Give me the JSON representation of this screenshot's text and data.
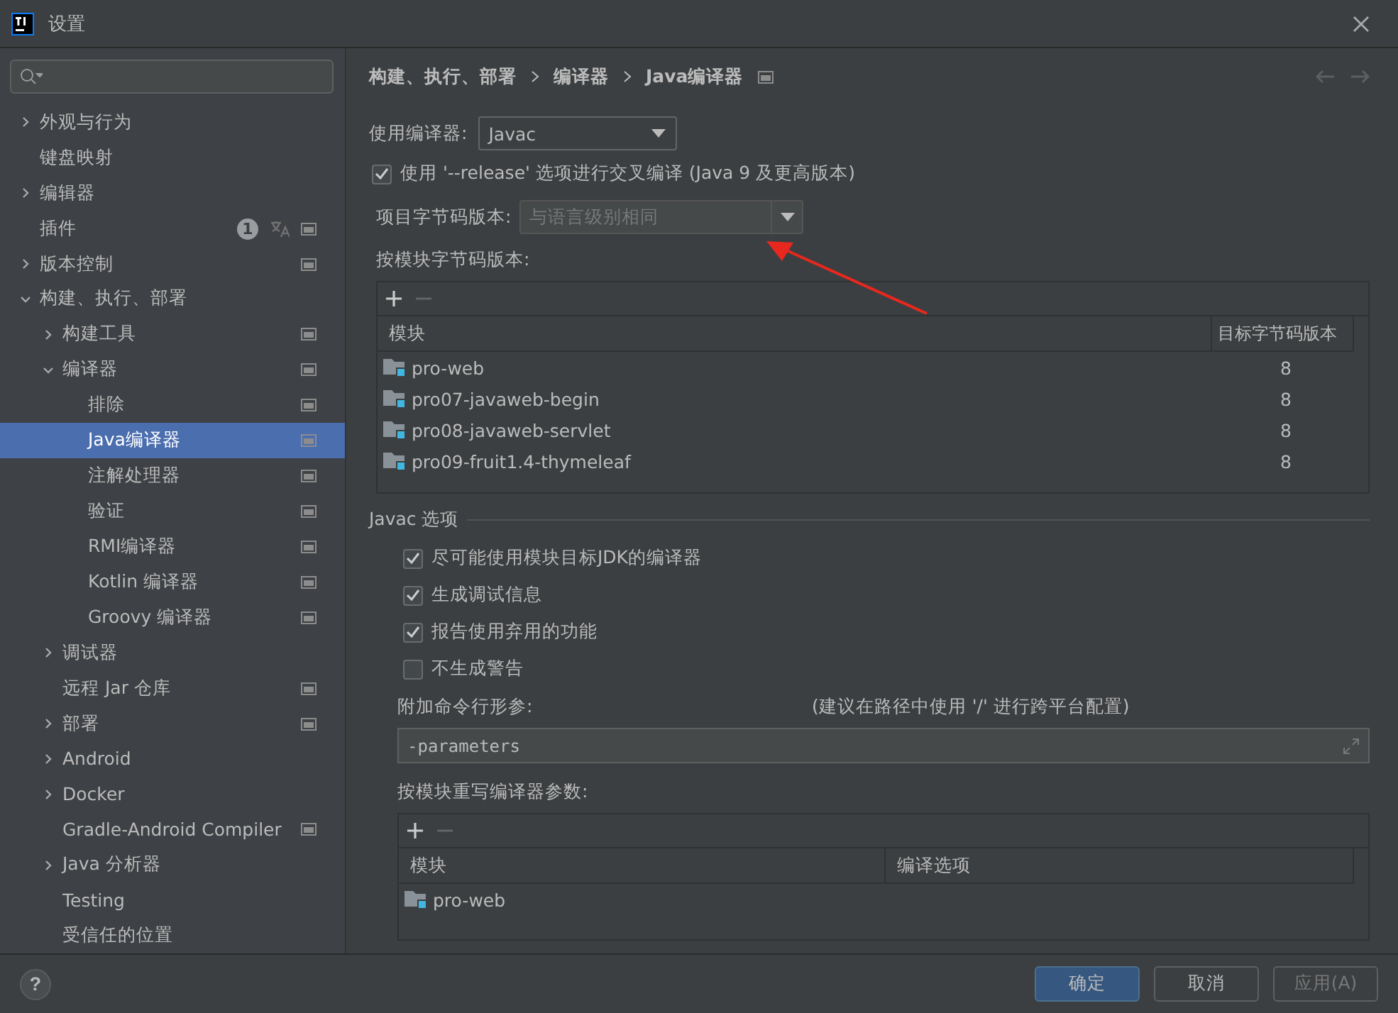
{
  "window": {
    "title": "设置"
  },
  "help": {
    "label": "?"
  },
  "sidebar": {
    "items": [
      {
        "label": "外观与行为",
        "expanded": false,
        "selected": false,
        "scoped": false
      },
      {
        "label": "键盘映射",
        "selected": false,
        "scoped": false
      },
      {
        "label": "编辑器",
        "expanded": false,
        "selected": false,
        "scoped": false
      },
      {
        "label": "插件",
        "selected": false,
        "scoped": true,
        "count": "1",
        "translate": true
      },
      {
        "label": "版本控制",
        "expanded": false,
        "selected": false,
        "scoped": true
      },
      {
        "label": "构建、执行、部署",
        "expanded": true,
        "selected": false,
        "scoped": false,
        "children": [
          {
            "label": "构建工具",
            "expanded": false,
            "selected": false,
            "scoped": true
          },
          {
            "label": "编译器",
            "expanded": true,
            "selected": false,
            "scoped": true,
            "children": [
              {
                "label": "排除",
                "selected": false,
                "scoped": true
              },
              {
                "label": "Java编译器",
                "selected": true,
                "scoped": true
              },
              {
                "label": "注解处理器",
                "selected": false,
                "scoped": true
              },
              {
                "label": "验证",
                "selected": false,
                "scoped": true
              },
              {
                "label": "RMI编译器",
                "selected": false,
                "scoped": true
              },
              {
                "label": "Kotlin 编译器",
                "selected": false,
                "scoped": true
              },
              {
                "label": "Groovy 编译器",
                "selected": false,
                "scoped": true
              }
            ]
          },
          {
            "label": "调试器",
            "expanded": false,
            "selected": false,
            "scoped": false
          },
          {
            "label": "远程 Jar 仓库",
            "selected": false,
            "scoped": true
          },
          {
            "label": "部署",
            "expanded": false,
            "selected": false,
            "scoped": true
          },
          {
            "label": "Android",
            "expanded": false,
            "selected": false,
            "scoped": false
          },
          {
            "label": "Docker",
            "expanded": false,
            "selected": false,
            "scoped": false
          },
          {
            "label": "Gradle-Android Compiler",
            "selected": false,
            "scoped": true
          },
          {
            "label": "Java 分析器",
            "expanded": false,
            "selected": false,
            "scoped": false
          },
          {
            "label": "Testing",
            "selected": false,
            "scoped": false
          },
          {
            "label": "受信任的位置",
            "selected": false,
            "scoped": false
          }
        ]
      }
    ]
  },
  "breadcrumb": [
    "构建、执行、部署",
    "编译器",
    "Java编译器"
  ],
  "compiler": {
    "label": "使用编译器:",
    "value": "Javac"
  },
  "release_option": {
    "label": "使用 '--release' 选项进行交叉编译 (Java 9 及更高版本)",
    "checked": true
  },
  "project_bytecode": {
    "label": "项目字节码版本:",
    "placeholder": "与语言级别相同"
  },
  "module_bytecode": {
    "label": "按模块字节码版本:",
    "columns": [
      "模块",
      "目标字节码版本"
    ],
    "rows": [
      {
        "module": "pro-web",
        "version": "8"
      },
      {
        "module": "pro07-javaweb-begin",
        "version": "8"
      },
      {
        "module": "pro08-javaweb-servlet",
        "version": "8"
      },
      {
        "module": "pro09-fruit1.4-thymeleaf",
        "version": "8"
      }
    ]
  },
  "javac": {
    "title": "Javac 选项",
    "options": [
      {
        "label": "尽可能使用模块目标JDK的编译器",
        "checked": true
      },
      {
        "label": "生成调试信息",
        "checked": true
      },
      {
        "label": "报告使用弃用的功能",
        "checked": true
      },
      {
        "label": "不生成警告",
        "checked": false
      }
    ],
    "params_label": "附加命令行形参:",
    "params_hint": "(建议在路径中使用 '/' 进行跨平台配置)",
    "params_value": "-parameters",
    "override_label": "按模块重写编译器参数:",
    "columns": [
      "模块",
      "编译选项"
    ],
    "rows": [
      {
        "module": "pro-web"
      }
    ]
  },
  "buttons": [
    {
      "label": "确定",
      "kind": "primary",
      "disabled": false
    },
    {
      "label": "取消",
      "kind": "normal",
      "disabled": false
    },
    {
      "label": "应用(A)",
      "kind": "normal",
      "disabled": true
    }
  ]
}
